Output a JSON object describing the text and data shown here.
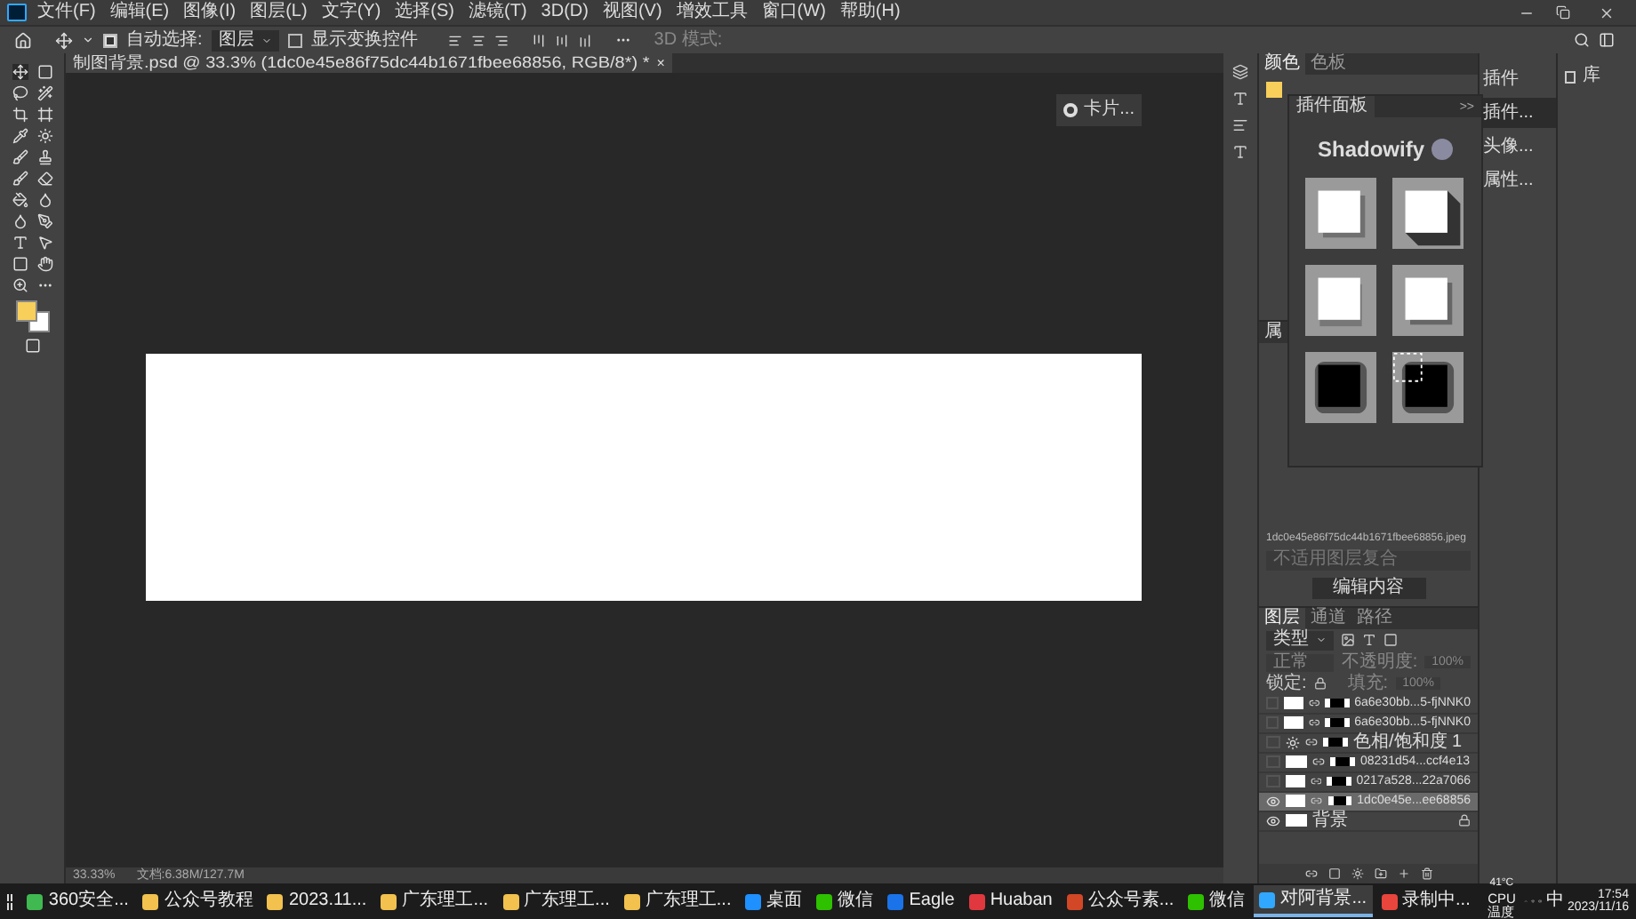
{
  "menu": [
    "文件(F)",
    "编辑(E)",
    "图像(I)",
    "图层(L)",
    "文字(Y)",
    "选择(S)",
    "滤镜(T)",
    "3D(D)",
    "视图(V)",
    "增效工具",
    "窗口(W)",
    "帮助(H)"
  ],
  "options": {
    "auto_select_label": "自动选择:",
    "auto_select_checked": true,
    "auto_select_target": "图层",
    "show_transform_label": "显示变换控件",
    "show_transform_checked": false,
    "mode_3d": "3D 模式:"
  },
  "document_tab": {
    "title": "制图背景.psd @ 33.3% (1dc0e45e86f75dc44b1671fbee68856, RGB/8*) *",
    "close": "×"
  },
  "canvas_popup": {
    "label": "卡片..."
  },
  "status_bar": {
    "zoom": "33.33%",
    "doc": "文档:6.38M/127.7M"
  },
  "color_panel": {
    "tabs": [
      {
        "label": "颜色",
        "selected": true
      },
      {
        "label": "色板",
        "selected": false
      }
    ]
  },
  "plugin_panel": {
    "tab": "插件面板",
    "expand": ">>",
    "title": "Shadowify",
    "presets": [
      {
        "kind": "drop"
      },
      {
        "kind": "long"
      },
      {
        "kind": "bottom"
      },
      {
        "kind": "corner"
      },
      {
        "kind": "blur"
      },
      {
        "kind": "blur-select"
      }
    ]
  },
  "properties": {
    "tab": "属",
    "file": "1dc0e45e86f75dc44b1671fbee68856.jpeg",
    "comp": "不适用图层复合",
    "button": "编辑内容"
  },
  "collapsed_panels": [
    {
      "label": "插件",
      "selected": false
    },
    {
      "label": "插件...",
      "selected": true
    },
    {
      "label": "头像...",
      "selected": false
    },
    {
      "label": "属性...",
      "selected": false
    }
  ],
  "library_panel": {
    "label": "库"
  },
  "layers_panel": {
    "tabs": [
      {
        "label": "图层",
        "selected": true
      },
      {
        "label": "通道",
        "selected": false
      },
      {
        "label": "路径",
        "selected": false
      }
    ],
    "filter": "类型",
    "blend": "正常",
    "opacity_label": "不透明度:",
    "opacity": "100%",
    "lock_label": "锁定:",
    "fill_label": "填充:",
    "fill": "100%",
    "layers": [
      {
        "name": "6a6e30bb...5-fjNNK0",
        "kind": "smart",
        "visible": false,
        "selected": false
      },
      {
        "name": "6a6e30bb...5-fjNNK0",
        "kind": "smart",
        "visible": false,
        "selected": false
      },
      {
        "name": "色相/饱和度 1",
        "kind": "adjustment",
        "visible": false,
        "selected": false
      },
      {
        "name": "08231d54...ccf4e13",
        "kind": "smart",
        "visible": false,
        "selected": false
      },
      {
        "name": "0217a528...22a7066",
        "kind": "smart",
        "visible": false,
        "selected": false
      },
      {
        "name": "1dc0e45e...ee68856",
        "kind": "smart",
        "visible": true,
        "selected": true
      },
      {
        "name": "背景",
        "kind": "background",
        "visible": true,
        "selected": false
      }
    ]
  },
  "taskbar": {
    "items": [
      {
        "label": "360安全...",
        "color": "#3fb950",
        "active": false
      },
      {
        "label": "公众号教程",
        "color": "#f2c14e",
        "active": false
      },
      {
        "label": "2023.11...",
        "color": "#f2c14e",
        "active": false
      },
      {
        "label": "广东理工...",
        "color": "#f2c14e",
        "active": false
      },
      {
        "label": "广东理工...",
        "color": "#f2c14e",
        "active": false
      },
      {
        "label": "广东理工...",
        "color": "#f2c14e",
        "active": false
      },
      {
        "label": "桌面",
        "color": "#1e90ff",
        "active": false
      },
      {
        "label": "微信",
        "color": "#2dc100",
        "active": false
      },
      {
        "label": "Eagle",
        "color": "#1a73e8",
        "active": false
      },
      {
        "label": "Huaban",
        "color": "#e0383e",
        "active": false
      },
      {
        "label": "公众号素...",
        "color": "#d24726",
        "active": false
      },
      {
        "label": "微信",
        "color": "#2dc100",
        "active": false
      },
      {
        "label": "对阿背景...",
        "color": "#31a8ff",
        "active": true
      },
      {
        "label": "录制中...",
        "color": "#e8453c",
        "active": false
      }
    ],
    "temp": "41°C",
    "cpu": "CPU温度",
    "ime": "中",
    "time": "17:54",
    "date": "2023/11/16"
  }
}
